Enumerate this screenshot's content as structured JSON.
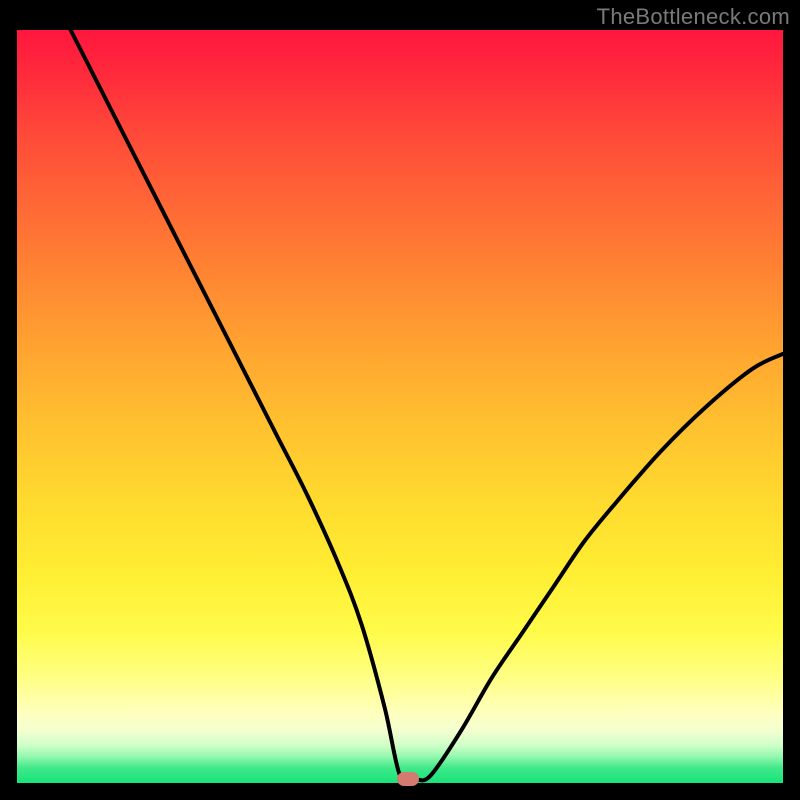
{
  "watermark": "TheBottleneck.com",
  "colors": {
    "curve": "#000000",
    "marker": "#d47a6f",
    "frame_bg": "#000000"
  },
  "chart_data": {
    "type": "line",
    "title": "",
    "xlabel": "",
    "ylabel": "",
    "xlim": [
      0,
      100
    ],
    "ylim": [
      0,
      100
    ],
    "grid": false,
    "legend": false,
    "notes": "Axes are unlabeled; values in [0,100] on both axes are estimated from pixel positions. Curve descends from upper-left, reaches minimum (~0) near x≈50, briefly flattens, then rises to ~57 at right edge. Background is a vertical gradient from red (top) through orange/yellow to green (bottom). A small rounded marker sits at the minimum.",
    "series": [
      {
        "name": "curve",
        "x": [
          7,
          10,
          14,
          18,
          22,
          26,
          30,
          34,
          38,
          42,
          45,
          48,
          50,
          52,
          54,
          58,
          62,
          66,
          70,
          74,
          78,
          84,
          90,
          96,
          100
        ],
        "y": [
          100,
          94,
          86,
          78,
          70,
          62,
          54,
          46,
          38,
          29,
          21,
          10,
          1,
          0.5,
          1,
          7,
          14,
          20,
          26,
          32,
          37,
          44,
          50,
          55,
          57
        ]
      }
    ],
    "marker": {
      "x": 51,
      "y": 0.5
    }
  }
}
